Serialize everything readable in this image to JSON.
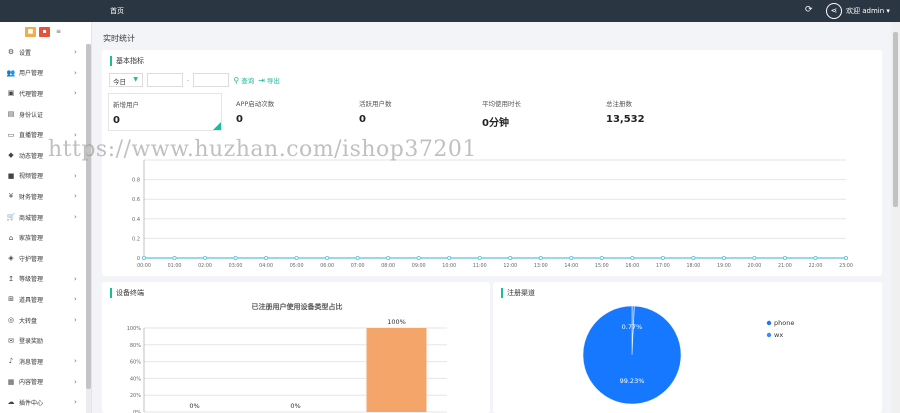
{
  "topbar": {
    "home_tab": "首页",
    "refresh_icon": "refresh-icon",
    "share_icon": "share-icon",
    "user_label": "欢迎 admin ▾"
  },
  "sidebar": {
    "toolbar_icons": [
      "fullscreen-icon",
      "close-icon",
      "list-icon"
    ],
    "items": [
      {
        "label": "设置",
        "icon": "gear-icon",
        "arrow": true
      },
      {
        "label": "用户管理",
        "icon": "users-icon",
        "arrow": true
      },
      {
        "label": "代理管理",
        "icon": "id-card-icon",
        "arrow": true
      },
      {
        "label": "身份认证",
        "icon": "badge-icon",
        "arrow": false
      },
      {
        "label": "直播管理",
        "icon": "monitor-icon",
        "arrow": true
      },
      {
        "label": "动态管理",
        "icon": "bell-icon",
        "arrow": false
      },
      {
        "label": "视频管理",
        "icon": "video-icon",
        "arrow": true
      },
      {
        "label": "财务管理",
        "icon": "yen-icon",
        "arrow": true
      },
      {
        "label": "商城管理",
        "icon": "cart-icon",
        "arrow": true
      },
      {
        "label": "家族管理",
        "icon": "family-icon",
        "arrow": false
      },
      {
        "label": "守护管理",
        "icon": "shield-icon",
        "arrow": false
      },
      {
        "label": "等级管理",
        "icon": "level-icon",
        "arrow": true
      },
      {
        "label": "道具管理",
        "icon": "sitemap-icon",
        "arrow": true
      },
      {
        "label": "大转盘",
        "icon": "wheel-icon",
        "arrow": true
      },
      {
        "label": "登录奖励",
        "icon": "gift-icon",
        "arrow": false
      },
      {
        "label": "消息管理",
        "icon": "message-icon",
        "arrow": true
      },
      {
        "label": "内容管理",
        "icon": "content-icon",
        "arrow": true
      },
      {
        "label": "插件中心",
        "icon": "plugin-icon",
        "arrow": true
      }
    ]
  },
  "main": {
    "page_title": "实时统计",
    "basic": {
      "title": "基本指标",
      "period_select": "今日",
      "date_separator": "-",
      "query_label": "查询",
      "export_label": "导出",
      "stats": [
        {
          "label": "新增用户",
          "value": "0"
        },
        {
          "label": "APP启动次数",
          "value": "0"
        },
        {
          "label": "活跃用户数",
          "value": "0"
        },
        {
          "label": "平均使用时长",
          "value": "0分钟"
        },
        {
          "label": "总注册数",
          "value": "13,532"
        }
      ]
    },
    "device_title": "设备终端",
    "register_title": "注册渠道"
  },
  "watermark": "https://www.huzhan.com/ishop37201",
  "colors": {
    "accent": "#1abc9c",
    "topbar": "#2b3643",
    "line": "#5bc0de",
    "bar": "#f4a66a",
    "pie_phone": "#1677ff",
    "pie_wx": "#3b8cff"
  },
  "chart_data": [
    {
      "type": "line",
      "title": "",
      "x": [
        "00:00",
        "01:00",
        "02:00",
        "03:00",
        "04:00",
        "05:00",
        "06:00",
        "07:00",
        "08:00",
        "09:00",
        "10:00",
        "11:00",
        "12:00",
        "13:00",
        "14:00",
        "15:00",
        "16:00",
        "17:00",
        "18:00",
        "19:00",
        "20:00",
        "21:00",
        "22:00",
        "23:00"
      ],
      "series": [
        {
          "values": [
            0,
            0,
            0,
            0,
            0,
            0,
            0,
            0,
            0,
            0,
            0,
            0,
            0,
            0,
            0,
            0,
            0,
            0,
            0,
            0,
            0,
            0,
            0,
            0
          ]
        }
      ],
      "yticks": [
        "0",
        "0.2",
        "0.4",
        "0.6",
        "0.8"
      ],
      "ylim": [
        0,
        1
      ],
      "grid": true
    },
    {
      "type": "bar",
      "title": "已注册用户使用设备类型占比",
      "categories": [
        "",
        "",
        ""
      ],
      "values": [
        0,
        0,
        100
      ],
      "labels": [
        "0%",
        "0%",
        "100%"
      ],
      "yticks": [
        "0%",
        "20%",
        "40%",
        "60%",
        "80%",
        "100%"
      ],
      "ylim": [
        0,
        100
      ]
    },
    {
      "type": "pie",
      "slices": [
        {
          "name": "phone",
          "value": 99.23,
          "label": "99.23%"
        },
        {
          "name": "wx",
          "value": 0.77,
          "label": "0.77%"
        }
      ],
      "legend": "right"
    }
  ]
}
